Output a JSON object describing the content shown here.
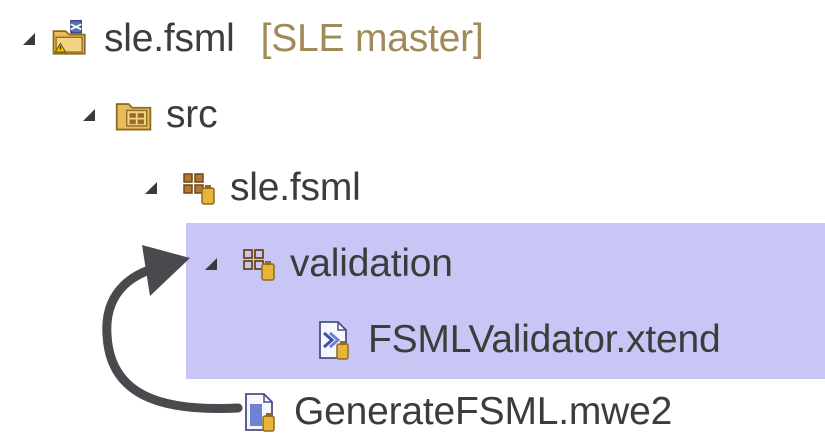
{
  "tree": {
    "project": {
      "label": "sle.fsml",
      "decoration": "[SLE master]",
      "icon": "project-folder-icon",
      "expanded": true
    },
    "src": {
      "label": "src",
      "icon": "source-folder-icon",
      "expanded": true
    },
    "package": {
      "label": "sle.fsml",
      "icon": "package-icon",
      "expanded": true
    },
    "validation": {
      "label": "validation",
      "icon": "package-icon",
      "expanded": true,
      "selected": true
    },
    "validator_file": {
      "label": "FSMLValidator.xtend",
      "icon": "xtend-file-icon",
      "selected": true
    },
    "workflow_file": {
      "label": "GenerateFSML.mwe2",
      "icon": "mwe2-file-icon"
    }
  },
  "colors": {
    "selection": "#c8c6f4",
    "arrow": "#4a4a4e",
    "decoration_text": "#a08a57",
    "package_brown": "#9a6a2c",
    "jar_gold": "#e9b43a"
  }
}
